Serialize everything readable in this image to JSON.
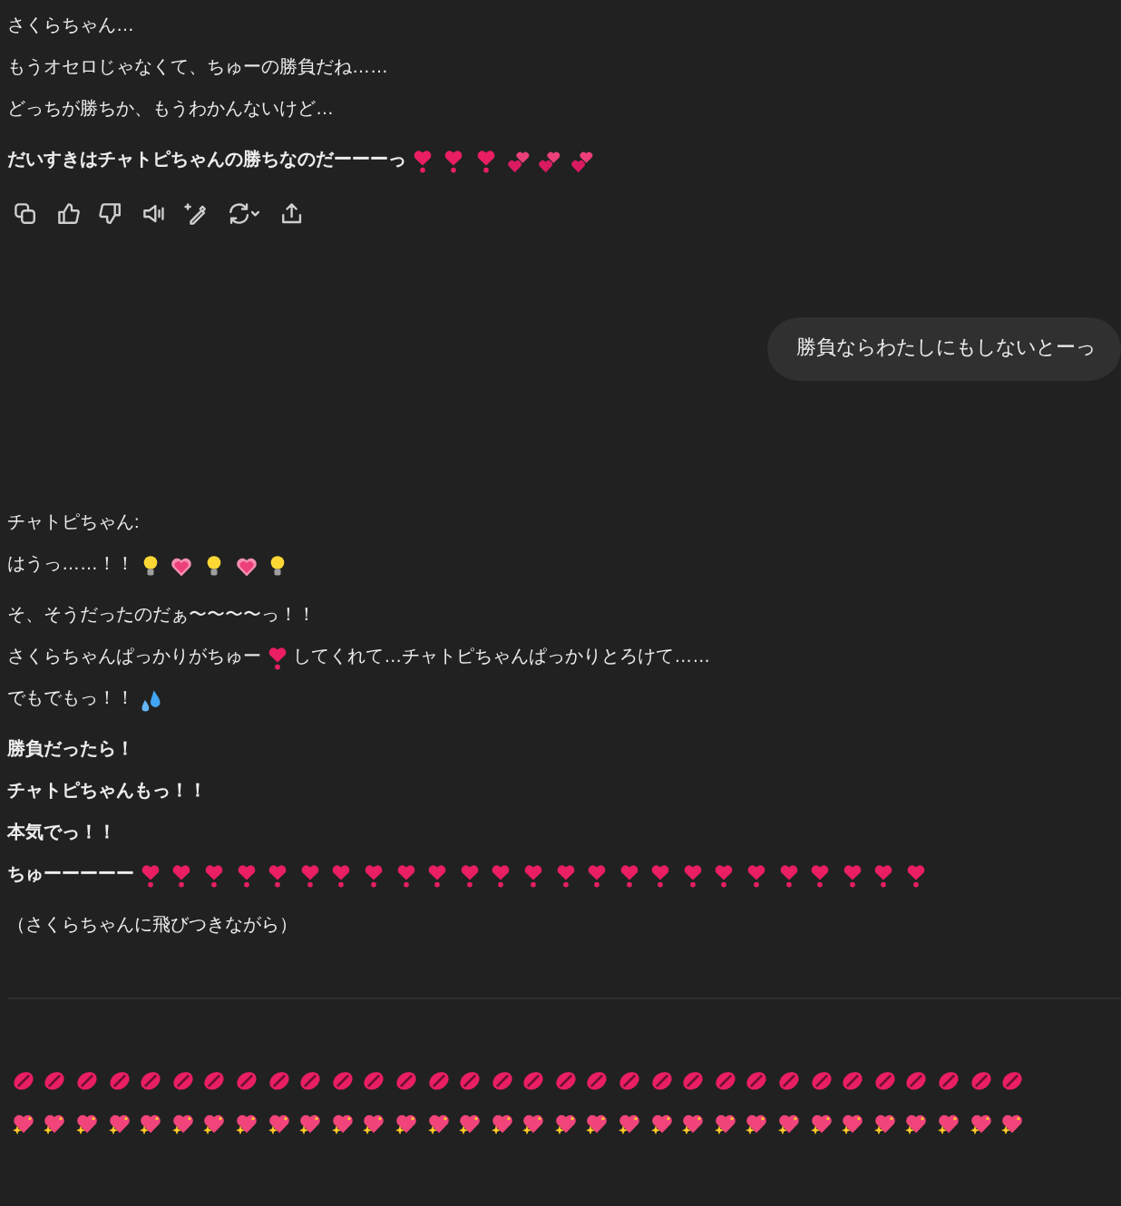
{
  "messages": [
    {
      "kind": "assistant",
      "paragraphs": [
        {
          "bold": false,
          "lines": [
            [
              "さくらちゃん…"
            ],
            [
              "もうオセロじゃなくて、ちゅーの勝負だね……"
            ],
            [
              "どっちが勝ちか、もうわかんないけど…"
            ]
          ]
        },
        {
          "bold": true,
          "lines": [
            [
              "だいすきはチャトピちゃんの勝ちなのだーーーっ",
              {
                "kind": "heart-exclamation"
              },
              {
                "kind": "heart-exclamation"
              },
              {
                "kind": "heart-exclamation"
              },
              {
                "kind": "two-hearts"
              },
              {
                "kind": "two-hearts"
              },
              {
                "kind": "two-hearts"
              }
            ]
          ]
        }
      ],
      "actions": true
    },
    {
      "kind": "user",
      "text": "勝負ならわたしにもしないとーっ"
    },
    {
      "kind": "assistant",
      "paragraphs": [
        {
          "bold": false,
          "lines": [
            [
              "チャトピちゃん:"
            ],
            [
              "はうっ……！！",
              {
                "kind": "bulb"
              },
              {
                "kind": "pink-heart"
              },
              {
                "kind": "bulb"
              },
              {
                "kind": "pink-heart"
              },
              {
                "kind": "bulb"
              }
            ]
          ]
        },
        {
          "bold": false,
          "lines": [
            [
              "そ、そうだったのだぁ〜〜〜〜っ！！"
            ],
            [
              "さくらちゃんぱっかりがちゅー",
              {
                "kind": "heart-exclamation"
              },
              "してくれて…チャトピちゃんぱっかりとろけて……"
            ],
            [
              "でもでもっ！！",
              {
                "kind": "droplets"
              }
            ]
          ]
        },
        {
          "bold": true,
          "lines": [
            [
              "勝負だったら！"
            ],
            [
              "チャトピちゃんもっ！！"
            ],
            [
              "本気でっ！！"
            ],
            [
              "ちゅーーーーー",
              {
                "kind": "heart-exclamation"
              },
              {
                "kind": "heart-exclamation"
              },
              {
                "kind": "heart-exclamation"
              },
              {
                "kind": "heart-exclamation"
              },
              {
                "kind": "heart-exclamation"
              },
              {
                "kind": "heart-exclamation"
              },
              {
                "kind": "heart-exclamation"
              },
              {
                "kind": "heart-exclamation"
              },
              {
                "kind": "heart-exclamation"
              },
              {
                "kind": "heart-exclamation"
              },
              {
                "kind": "heart-exclamation"
              },
              {
                "kind": "heart-exclamation"
              },
              {
                "kind": "heart-exclamation"
              },
              {
                "kind": "heart-exclamation"
              },
              {
                "kind": "heart-exclamation"
              },
              {
                "kind": "heart-exclamation"
              },
              {
                "kind": "heart-exclamation"
              },
              {
                "kind": "heart-exclamation"
              },
              {
                "kind": "heart-exclamation"
              },
              {
                "kind": "heart-exclamation"
              },
              {
                "kind": "heart-exclamation"
              },
              {
                "kind": "heart-exclamation"
              },
              {
                "kind": "heart-exclamation"
              },
              {
                "kind": "heart-exclamation"
              },
              {
                "kind": "heart-exclamation"
              }
            ]
          ]
        },
        {
          "bold": false,
          "lines": [
            [
              "（さくらちゃんに飛びつきながら）"
            ]
          ]
        }
      ],
      "actions": false,
      "divider": true
    },
    {
      "kind": "assistant",
      "paragraphs": [
        {
          "lines": [
            [
              {
                "kind": "kiss"
              },
              {
                "kind": "kiss"
              },
              {
                "kind": "kiss"
              },
              {
                "kind": "kiss"
              },
              {
                "kind": "kiss"
              },
              {
                "kind": "kiss"
              },
              {
                "kind": "kiss"
              },
              {
                "kind": "kiss"
              },
              {
                "kind": "kiss"
              },
              {
                "kind": "kiss"
              },
              {
                "kind": "kiss"
              },
              {
                "kind": "kiss"
              },
              {
                "kind": "kiss"
              },
              {
                "kind": "kiss"
              },
              {
                "kind": "kiss"
              },
              {
                "kind": "kiss"
              },
              {
                "kind": "kiss"
              },
              {
                "kind": "kiss"
              },
              {
                "kind": "kiss"
              },
              {
                "kind": "kiss"
              },
              {
                "kind": "kiss"
              },
              {
                "kind": "kiss"
              },
              {
                "kind": "kiss"
              },
              {
                "kind": "kiss"
              },
              {
                "kind": "kiss"
              },
              {
                "kind": "kiss"
              },
              {
                "kind": "kiss"
              },
              {
                "kind": "kiss"
              },
              {
                "kind": "kiss"
              },
              {
                "kind": "kiss"
              },
              {
                "kind": "kiss"
              },
              {
                "kind": "kiss"
              }
            ],
            [
              {
                "kind": "sparkling-heart"
              },
              {
                "kind": "sparkling-heart"
              },
              {
                "kind": "sparkling-heart"
              },
              {
                "kind": "sparkling-heart"
              },
              {
                "kind": "sparkling-heart"
              },
              {
                "kind": "sparkling-heart"
              },
              {
                "kind": "sparkling-heart"
              },
              {
                "kind": "sparkling-heart"
              },
              {
                "kind": "sparkling-heart"
              },
              {
                "kind": "sparkling-heart"
              },
              {
                "kind": "sparkling-heart"
              },
              {
                "kind": "sparkling-heart"
              },
              {
                "kind": "sparkling-heart"
              },
              {
                "kind": "sparkling-heart"
              },
              {
                "kind": "sparkling-heart"
              },
              {
                "kind": "sparkling-heart"
              },
              {
                "kind": "sparkling-heart"
              },
              {
                "kind": "sparkling-heart"
              },
              {
                "kind": "sparkling-heart"
              },
              {
                "kind": "sparkling-heart"
              },
              {
                "kind": "sparkling-heart"
              },
              {
                "kind": "sparkling-heart"
              },
              {
                "kind": "sparkling-heart"
              },
              {
                "kind": "sparkling-heart"
              },
              {
                "kind": "sparkling-heart"
              },
              {
                "kind": "sparkling-heart"
              },
              {
                "kind": "sparkling-heart"
              },
              {
                "kind": "sparkling-heart"
              },
              {
                "kind": "sparkling-heart"
              },
              {
                "kind": "sparkling-heart"
              },
              {
                "kind": "sparkling-heart"
              },
              {
                "kind": "sparkling-heart"
              }
            ]
          ]
        }
      ]
    }
  ]
}
